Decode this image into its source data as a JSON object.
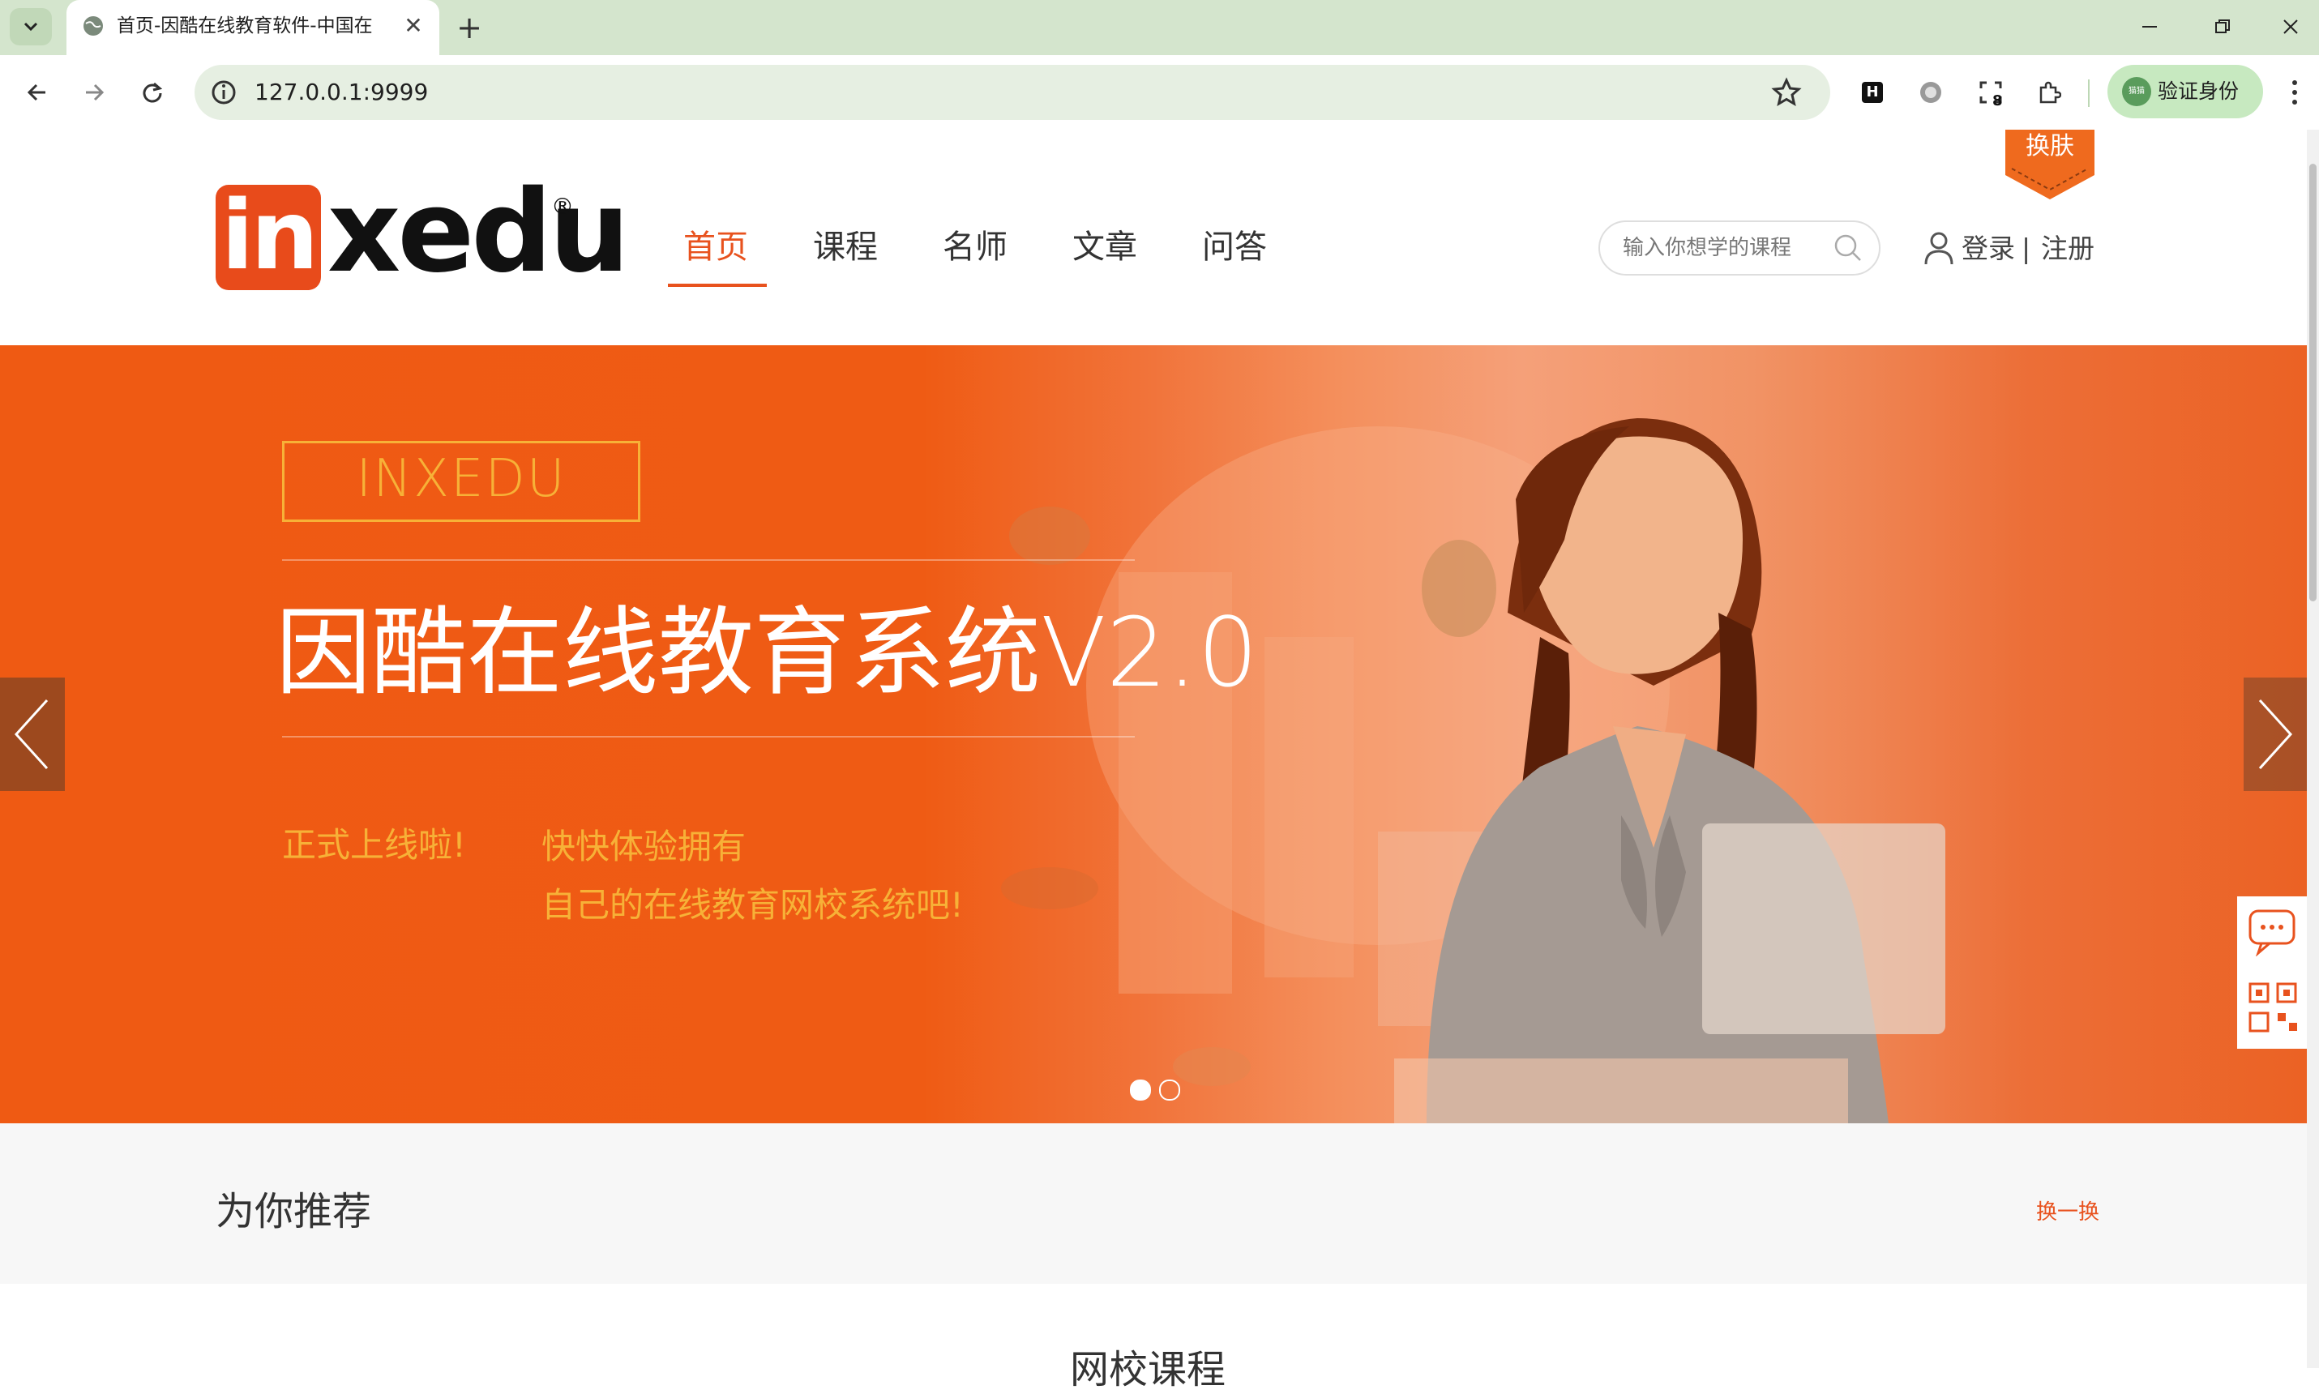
{
  "browser": {
    "tab_title": "首页-因酷在线教育软件-中国在",
    "url": "127.0.0.1:9999",
    "verify_label": "验证身份",
    "verify_avatar_text": "猫猫",
    "ext_badge": "8",
    "ext_h_label": "H"
  },
  "header": {
    "logo_in": "in",
    "logo_rest": "xedu",
    "logo_reg": "®",
    "nav": [
      {
        "label": "首页",
        "active": true
      },
      {
        "label": "课程",
        "active": false
      },
      {
        "label": "名师",
        "active": false
      },
      {
        "label": "文章",
        "active": false
      },
      {
        "label": "问答",
        "active": false
      }
    ],
    "search_placeholder": "输入你想学的课程",
    "login": "登录",
    "separator": "|",
    "register": "注册",
    "skin": "换肤"
  },
  "banner": {
    "brand": "INXEDU",
    "title": "因酷在线教育系统V2.0",
    "sub1": "正式上线啦!",
    "sub2": "快快体验拥有",
    "sub3": "自己的在线教育网校系统吧!",
    "slide_count": 2,
    "active_slide": 1
  },
  "recommend": {
    "title": "为你推荐",
    "refresh": "换一换"
  },
  "school": {
    "title": "网校课程"
  },
  "colors": {
    "accent": "#e8521e",
    "banner_orange": "#ef5a13",
    "brand_gold": "#f7b137",
    "tab_strip": "#d4e5cd"
  }
}
